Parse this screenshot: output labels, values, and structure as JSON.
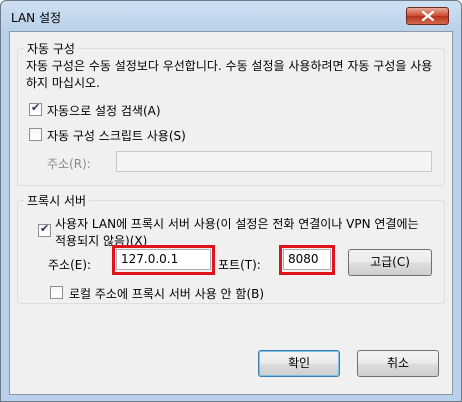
{
  "window": {
    "title": "LAN 설정"
  },
  "auto_config": {
    "group_label": "자동 구성",
    "description": "자동 구성은 수동 설정보다 우선합니다. 수동 설정을 사용하려면 자동 구성을 사용하지 마십시오.",
    "detect_label": "자동으로 설정 검색(A)",
    "detect_checked": true,
    "script_label": "자동 구성 스크립트 사용(S)",
    "script_checked": false,
    "address_label": "주소(R):",
    "address_value": ""
  },
  "proxy": {
    "group_label": "프록시 서버",
    "use_proxy_label": "사용자 LAN에 프록시 서버 사용(이 설정은 전화 연결이나 VPN 연결에는 적용되지 않음)(X)",
    "use_proxy_checked": true,
    "address_label": "주소(E):",
    "address_value": "127.0.0.1",
    "port_label": "포트(T):",
    "port_value": "8080",
    "advanced_label": "고급(C)",
    "bypass_label": "로컬 주소에 프록시 서버 사용 안 함(B)",
    "bypass_checked": false
  },
  "buttons": {
    "ok": "확인",
    "cancel": "취소"
  },
  "colors": {
    "highlight": "#e0141b",
    "title_gradient": "#b9d1ea"
  }
}
